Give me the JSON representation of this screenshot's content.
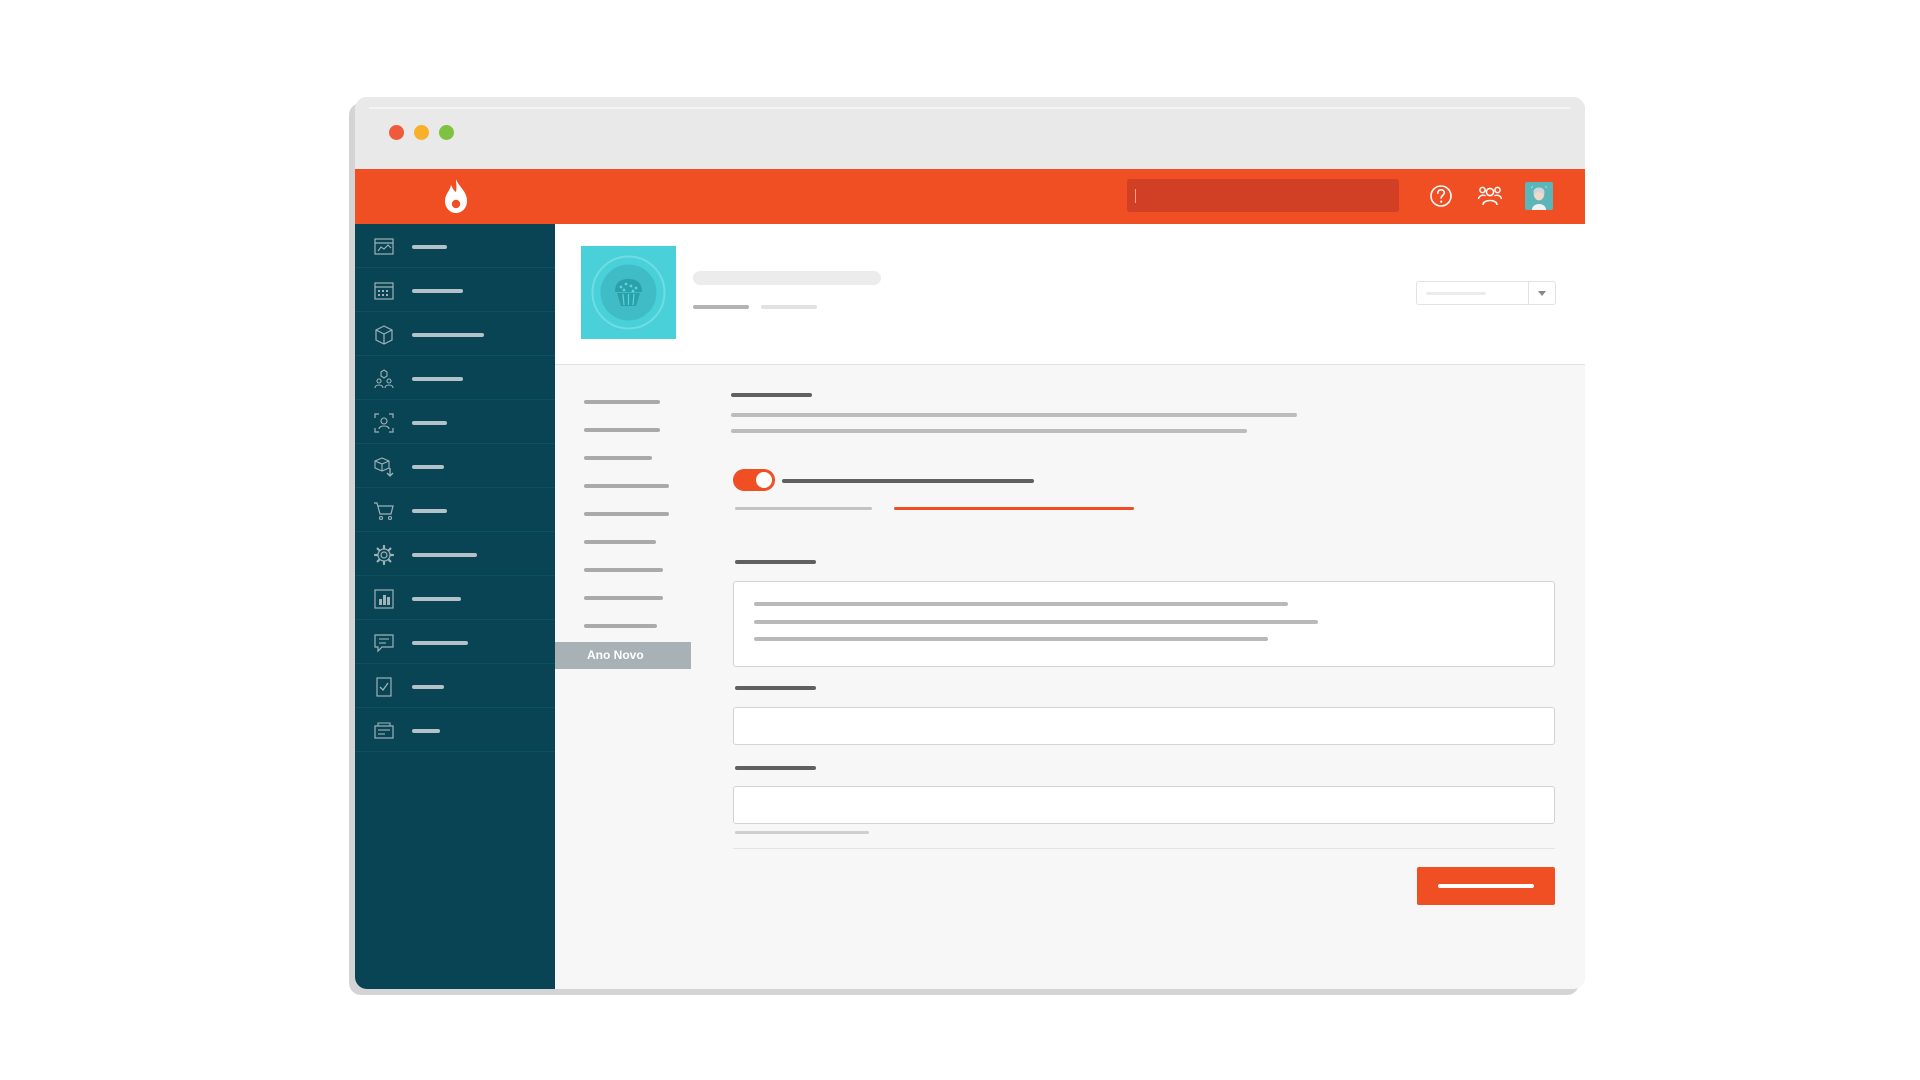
{
  "window": {
    "controls": [
      "close",
      "minimize",
      "maximize"
    ]
  },
  "topbar": {
    "brand_icon": "flame-icon",
    "search": {
      "value": "",
      "placeholder": ""
    },
    "icons": [
      "help-icon",
      "team-icon"
    ],
    "colors": {
      "accent": "#f04e23",
      "search_bg": "#d13f25"
    }
  },
  "sidebar": {
    "colors": {
      "background": "#084454"
    },
    "items": [
      {
        "icon": "dashboard-icon",
        "label": ""
      },
      {
        "icon": "members-area-icon",
        "label": ""
      },
      {
        "icon": "products-icon",
        "label": ""
      },
      {
        "icon": "affiliates-icon",
        "label": ""
      },
      {
        "icon": "audience-icon",
        "label": ""
      },
      {
        "icon": "product-delivery-icon",
        "label": ""
      },
      {
        "icon": "cart-icon",
        "label": ""
      },
      {
        "icon": "settings-icon",
        "label": ""
      },
      {
        "icon": "reports-icon",
        "label": ""
      },
      {
        "icon": "messages-icon",
        "label": ""
      },
      {
        "icon": "checklist-icon",
        "label": ""
      },
      {
        "icon": "tools-icon",
        "label": ""
      }
    ]
  },
  "product": {
    "thumbnail_icon": "cupcake-icon",
    "title": "",
    "subtitle": "",
    "dropdown_value": ""
  },
  "subnav": {
    "items": [
      "",
      "",
      "",
      "",
      "",
      "",
      "",
      "",
      ""
    ],
    "active_label": "Ano Novo"
  },
  "form": {
    "section_title": "",
    "description": "",
    "toggle_on": true,
    "toggle_label": "",
    "tabs": [
      {
        "label": "",
        "active": false
      },
      {
        "label": "",
        "active": true
      }
    ],
    "fields": [
      {
        "label": "",
        "value": "",
        "placeholder": ""
      },
      {
        "label": "",
        "value": "",
        "placeholder": ""
      },
      {
        "label": "",
        "value": "",
        "placeholder": ""
      }
    ],
    "helper_text": "",
    "submit_label": ""
  }
}
